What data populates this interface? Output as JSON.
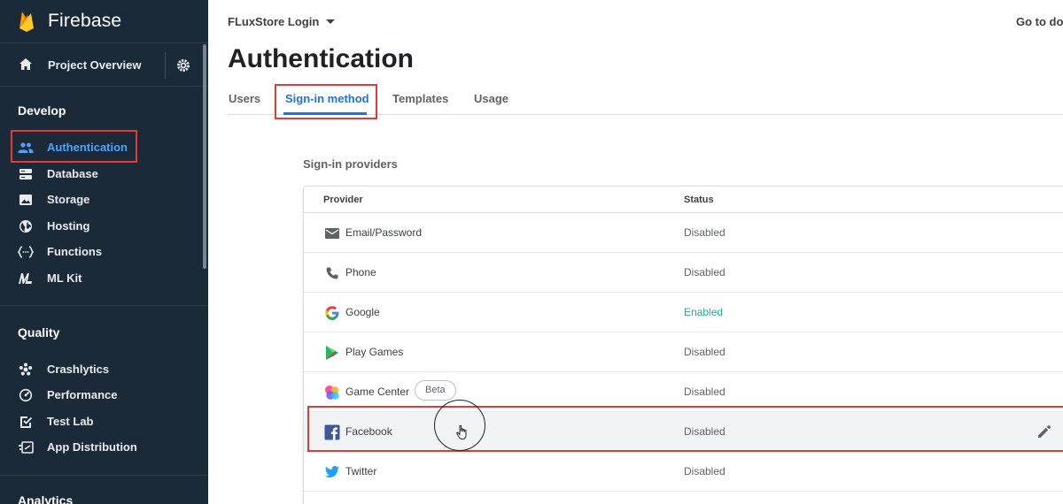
{
  "brand": {
    "name": "Firebase"
  },
  "overview": {
    "label": "Project Overview"
  },
  "sections": {
    "develop": "Develop",
    "quality": "Quality",
    "analytics": "Analytics"
  },
  "develop_items": [
    {
      "label": "Authentication",
      "icon": "people-icon"
    },
    {
      "label": "Database",
      "icon": "database-icon"
    },
    {
      "label": "Storage",
      "icon": "image-icon"
    },
    {
      "label": "Hosting",
      "icon": "globe-icon"
    },
    {
      "label": "Functions",
      "icon": "functions-icon"
    },
    {
      "label": "ML Kit",
      "icon": "ml-kit-icon"
    }
  ],
  "quality_items": [
    {
      "label": "Crashlytics",
      "icon": "crashlytics-icon"
    },
    {
      "label": "Performance",
      "icon": "speedometer-icon"
    },
    {
      "label": "Test Lab",
      "icon": "checklist-icon"
    },
    {
      "label": "App Distribution",
      "icon": "distribution-icon"
    }
  ],
  "header": {
    "project": "FLuxStore Login",
    "docs": "Go to doc",
    "title": "Authentication"
  },
  "tabs": [
    "Users",
    "Sign-in method",
    "Templates",
    "Usage"
  ],
  "providers": {
    "label": "Sign-in providers",
    "col_provider": "Provider",
    "col_status": "Status",
    "beta": "Beta",
    "rows": [
      {
        "name": "Email/Password",
        "status": "Disabled",
        "icon": "email-icon"
      },
      {
        "name": "Phone",
        "status": "Disabled",
        "icon": "phone-icon"
      },
      {
        "name": "Google",
        "status": "Enabled",
        "icon": "google-icon"
      },
      {
        "name": "Play Games",
        "status": "Disabled",
        "icon": "play-games-icon"
      },
      {
        "name": "Game Center",
        "status": "Disabled",
        "icon": "game-center-icon"
      },
      {
        "name": "Facebook",
        "status": "Disabled",
        "icon": "facebook-icon"
      },
      {
        "name": "Twitter",
        "status": "Disabled",
        "icon": "twitter-icon"
      }
    ]
  },
  "colors": {
    "sidebar_bg": "#1b2a38",
    "active_blue": "#4fa3f7",
    "tab_blue": "#1a73e8",
    "enabled_green": "#1eae8f",
    "highlight_red": "#e53935"
  }
}
